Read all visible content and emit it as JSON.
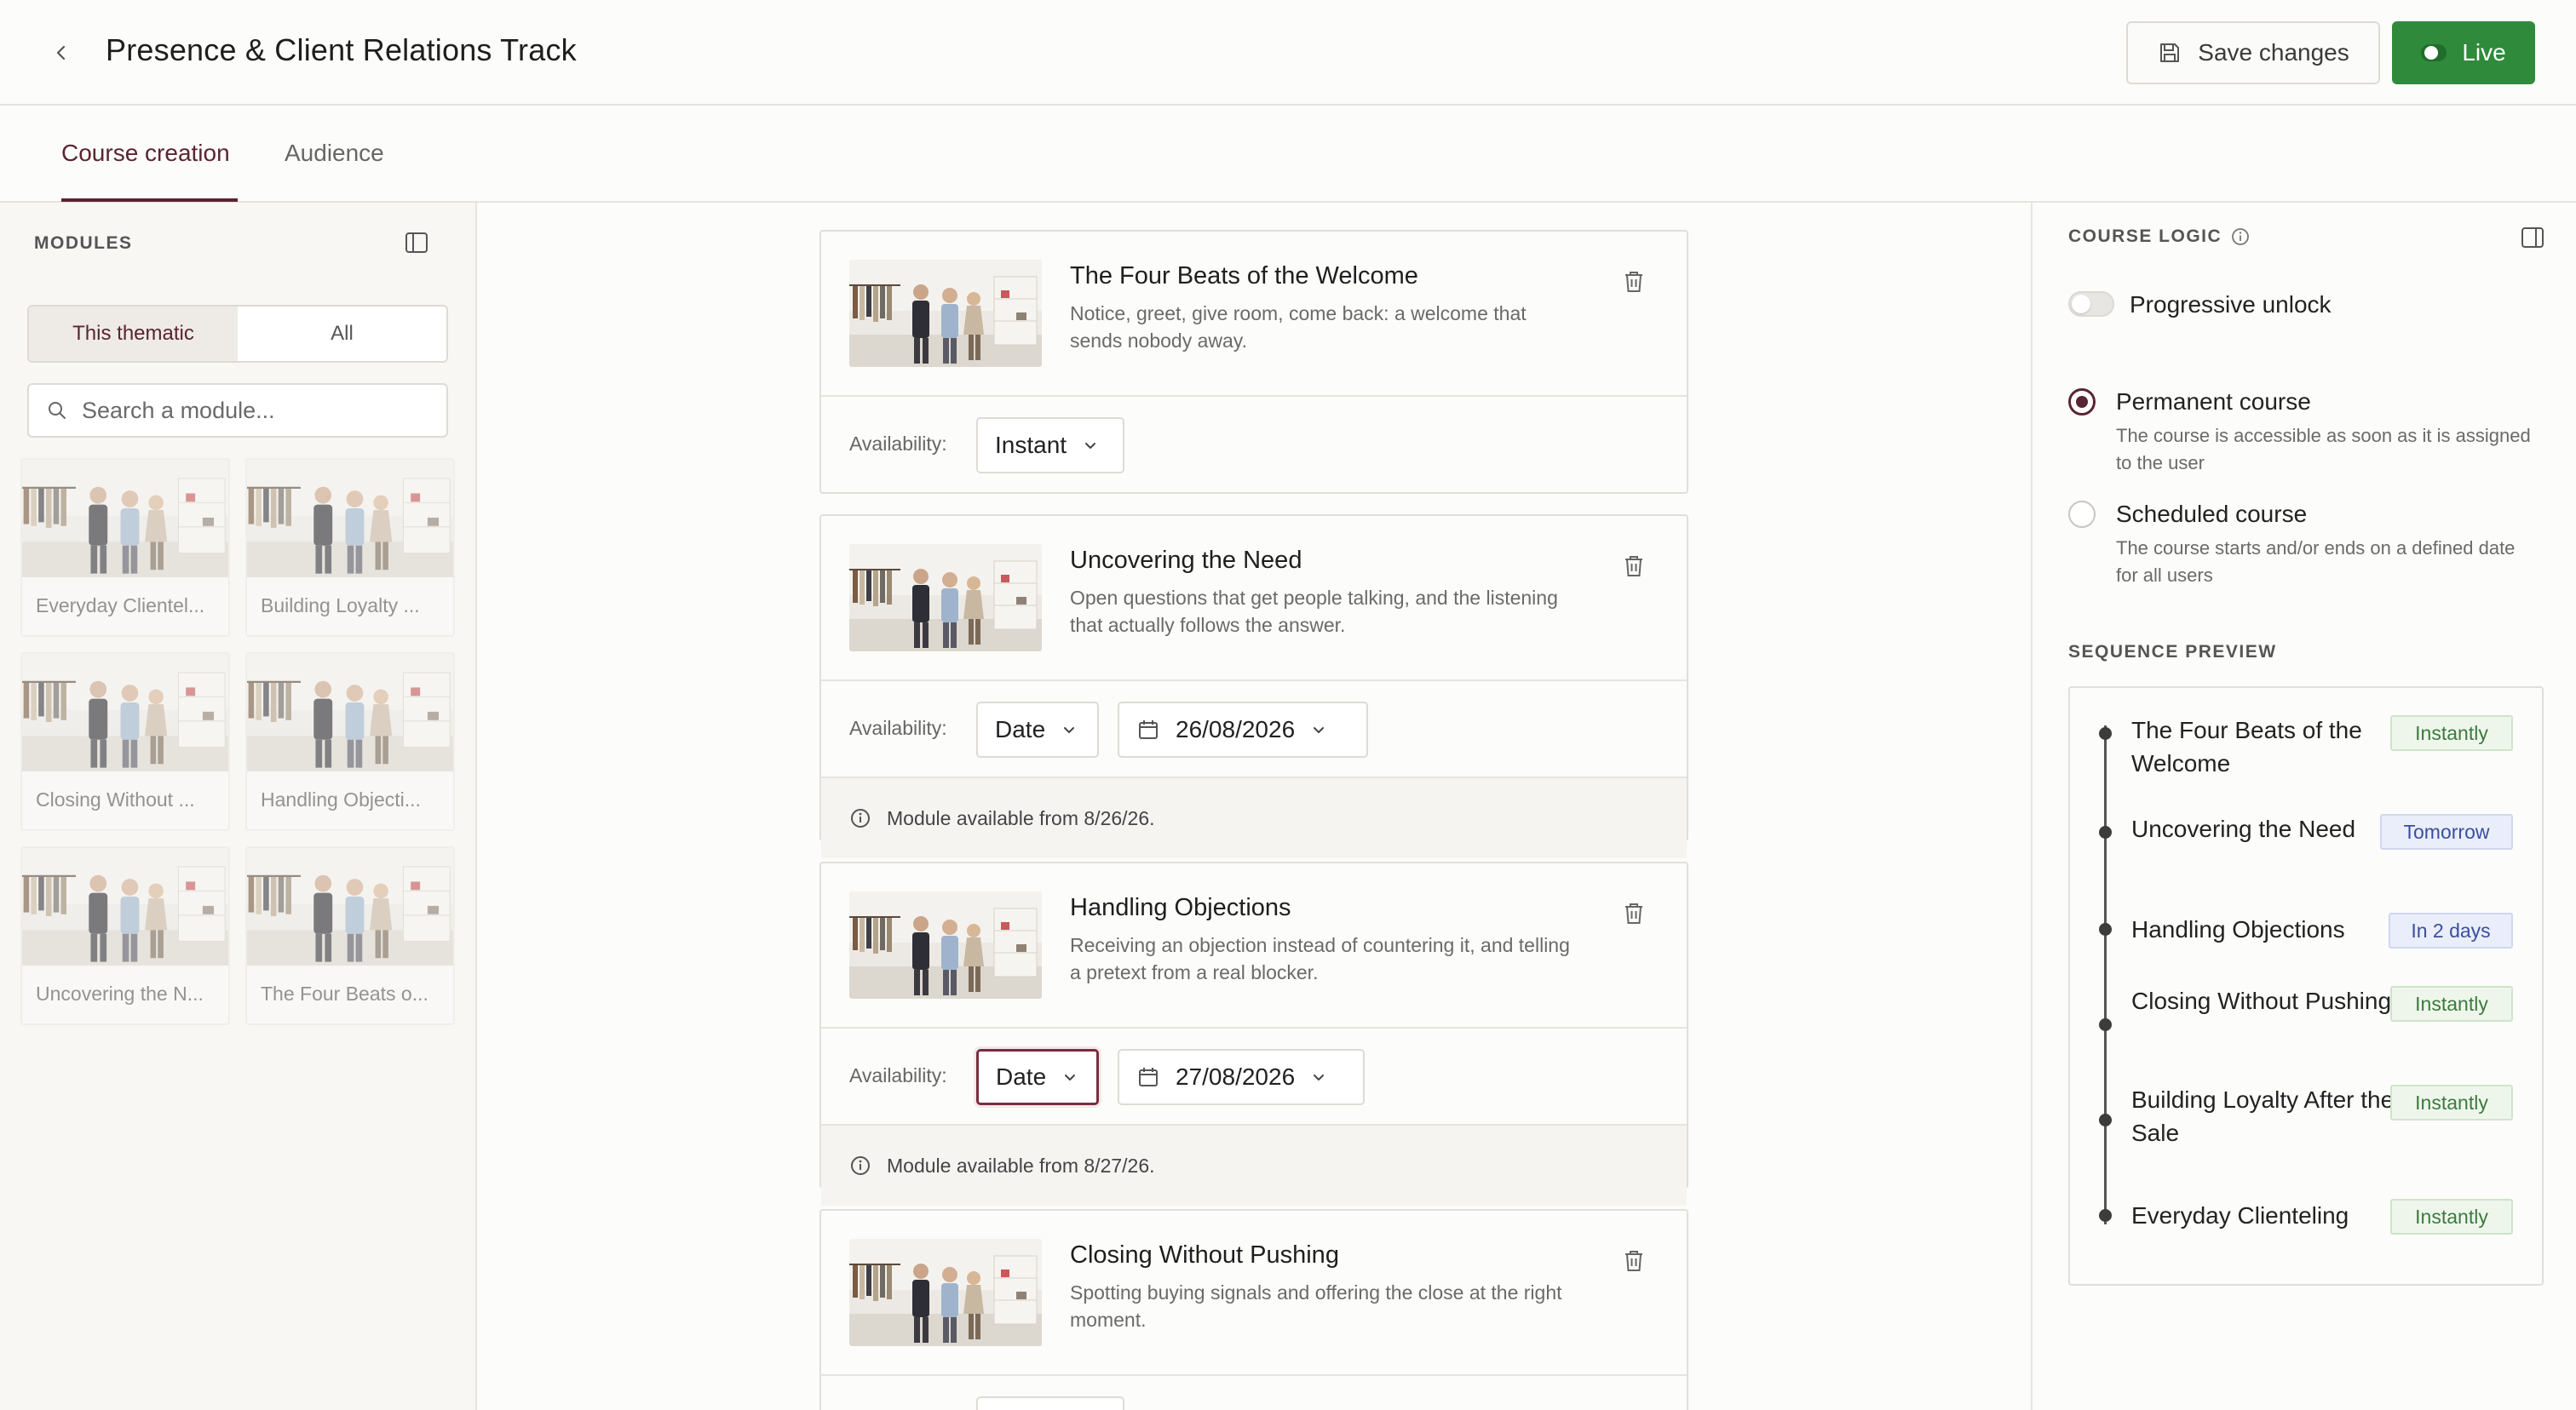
{
  "header": {
    "title": "Presence & Client Relations Track",
    "save_label": "Save changes",
    "live_label": "Live"
  },
  "tabs": [
    {
      "label": "Course creation",
      "active": true
    },
    {
      "label": "Audience",
      "active": false
    }
  ],
  "modules_panel": {
    "label": "MODULES",
    "filters": [
      "This thematic",
      "All"
    ],
    "search_placeholder": "Search a module...",
    "items": [
      {
        "caption": "Everyday Clientel..."
      },
      {
        "caption": "Building Loyalty ..."
      },
      {
        "caption": "Closing Without ..."
      },
      {
        "caption": "Handling Objecti..."
      },
      {
        "caption": "Uncovering the N..."
      },
      {
        "caption": "The Four Beats o..."
      }
    ]
  },
  "course_modules": [
    {
      "title": "The Four Beats of the Welcome",
      "description": "Notice, greet, give room, come back: a welcome that sends nobody away.",
      "availability_label": "Availability:",
      "availability": "Instant"
    },
    {
      "title": "Uncovering the Need",
      "description": "Open questions that get people talking, and the listening that actually follows the answer.",
      "availability_label": "Availability:",
      "availability": "Date",
      "date": "26/08/2026",
      "note": "Module available from 8/26/26."
    },
    {
      "title": "Handling Objections",
      "description": "Receiving an objection instead of countering it, and telling a pretext from a real blocker.",
      "availability_label": "Availability:",
      "availability": "Date",
      "date": "27/08/2026",
      "note": "Module available from 8/27/26."
    },
    {
      "title": "Closing Without Pushing",
      "description": "Spotting buying signals and offering the close at the right moment."
    }
  ],
  "course_logic": {
    "label": "COURSE LOGIC",
    "progressive_unlock": "Progressive unlock",
    "permanent": {
      "title": "Permanent course",
      "description": "The course is accessible as soon as it is assigned to the user",
      "selected": true
    },
    "scheduled": {
      "title": "Scheduled course",
      "description": "The course starts and/or ends on a defined date for all users",
      "selected": false
    },
    "sequence_label": "SEQUENCE PREVIEW",
    "sequence": [
      {
        "title": "The Four Beats of the Welcome",
        "badge": "Instantly"
      },
      {
        "title": "Uncovering the Need",
        "badge": "Tomorrow"
      },
      {
        "title": "Handling Objections",
        "badge": "In 2 days"
      },
      {
        "title": "Closing Without Pushing",
        "badge": "Instantly"
      },
      {
        "title": "Building Loyalty After the Sale",
        "badge": "Instantly"
      },
      {
        "title": "Everyday Clienteling",
        "badge": "Instantly"
      }
    ]
  },
  "colors": {
    "accent": "#5a2430",
    "live_green": "#2f8a3c",
    "badge_green": "#3d7a3e",
    "badge_blue": "#3a4f9c"
  }
}
